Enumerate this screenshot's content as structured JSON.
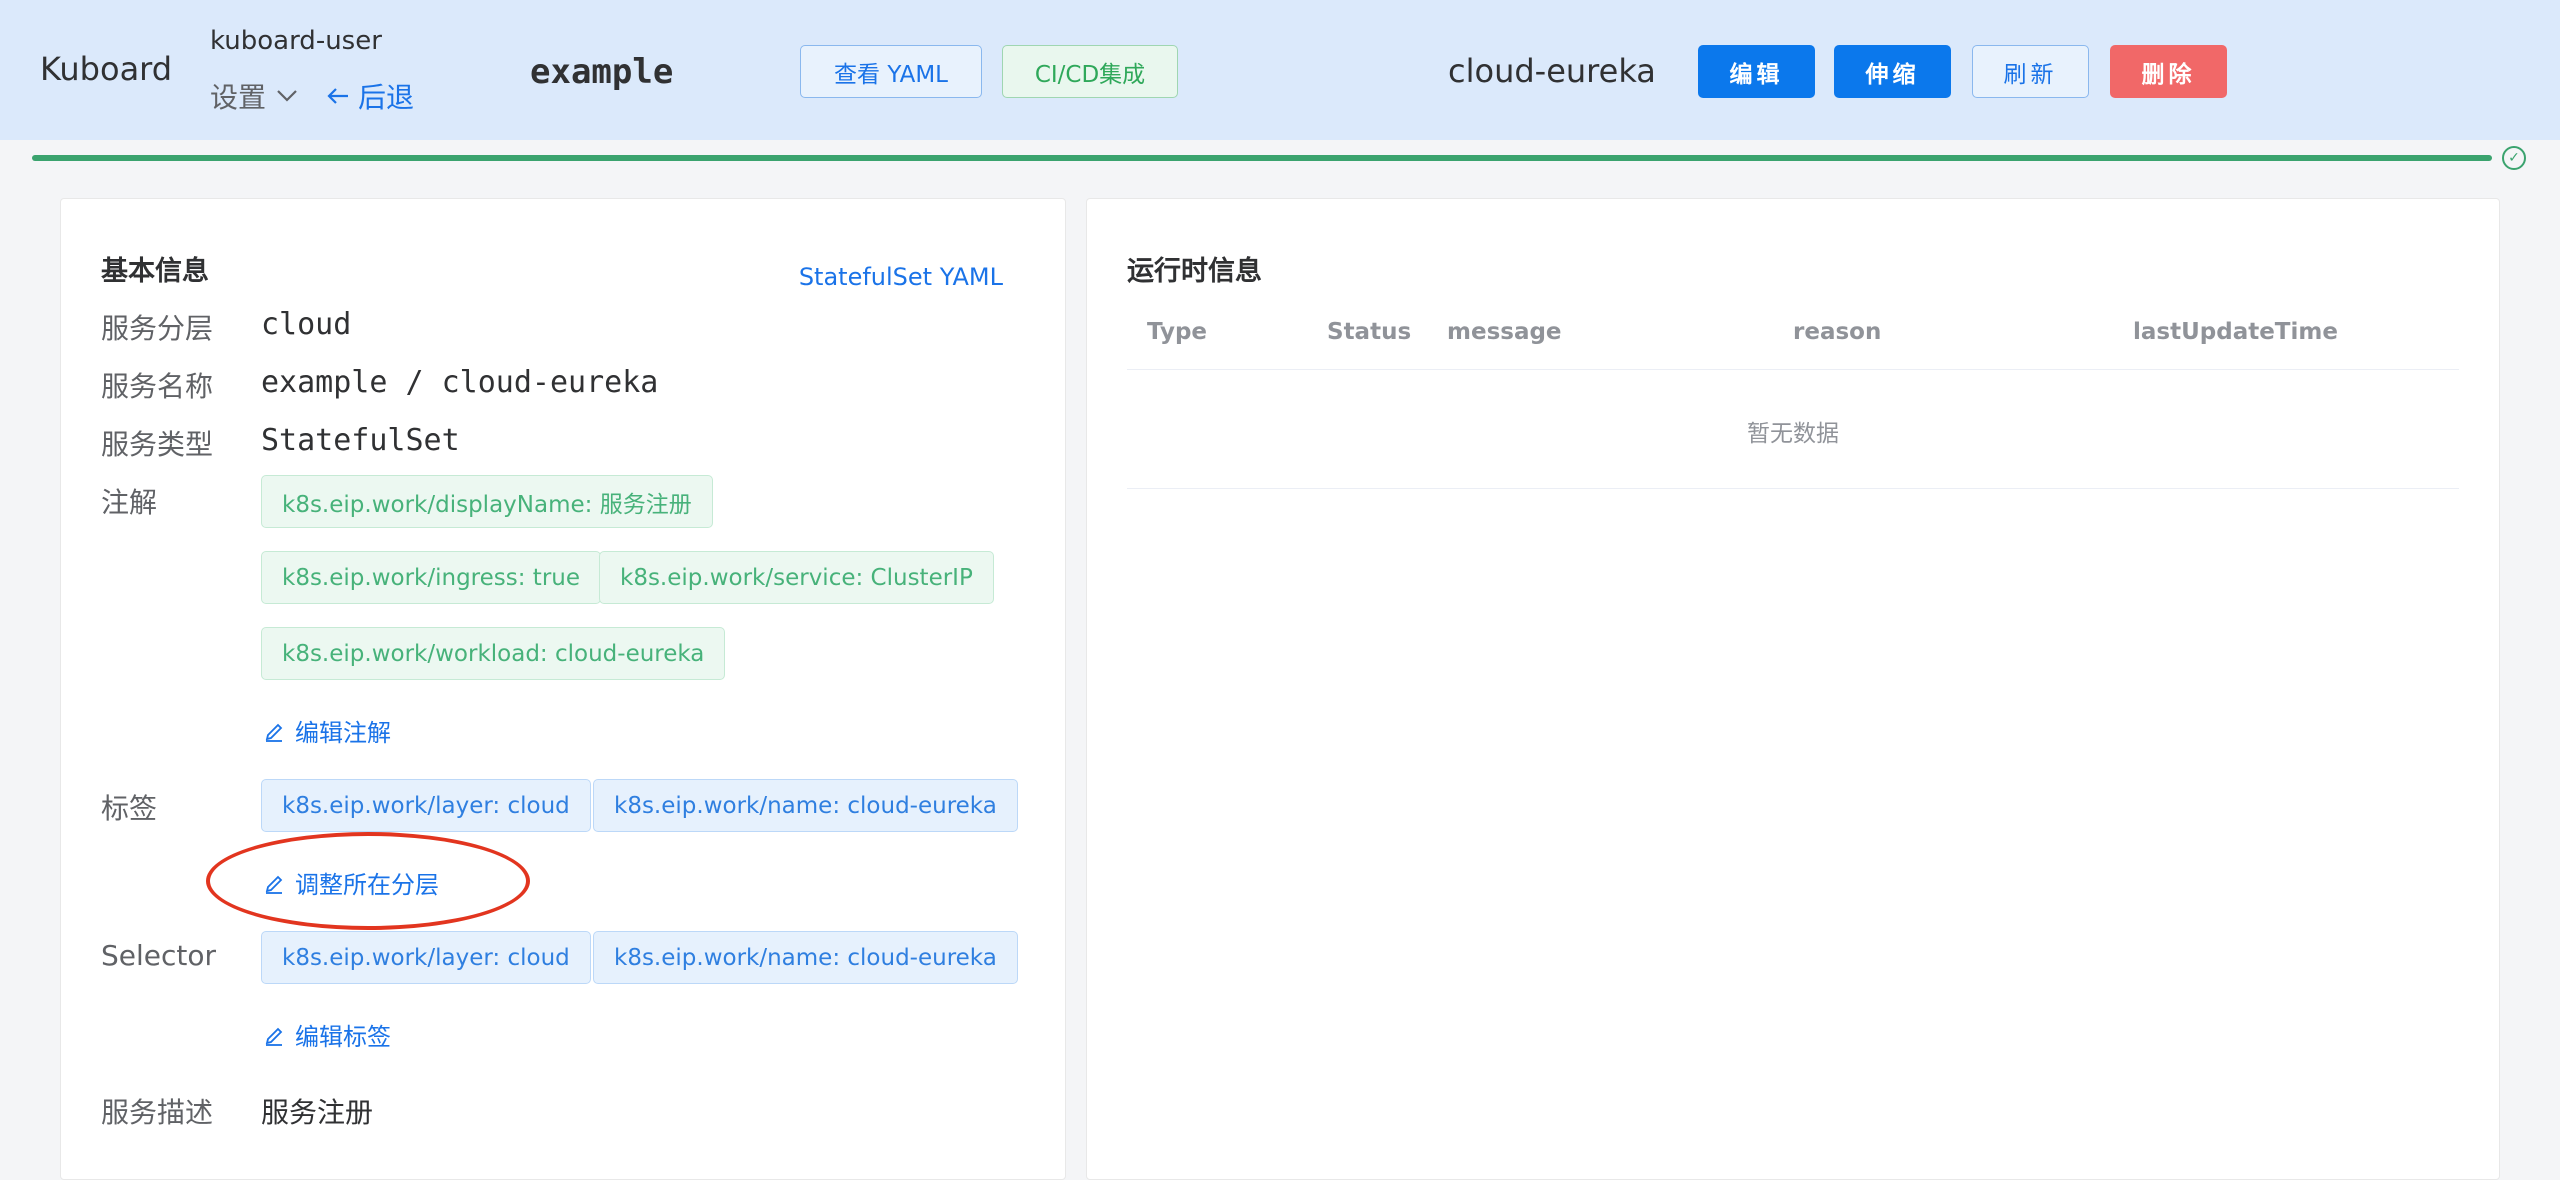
{
  "header": {
    "brand": "Kuboard",
    "user": "kuboard-user",
    "settings_label": "设置",
    "back_label": "后退",
    "namespace": "example",
    "view_yaml_label": "查看 YAML",
    "cicd_label": "CI/CD集成",
    "service_name": "cloud-eureka",
    "edit_label": "编辑",
    "scale_label": "伸缩",
    "refresh_label": "刷新",
    "delete_label": "删除"
  },
  "progress": {
    "percent": 100
  },
  "basic_info": {
    "title": "基本信息",
    "yaml_link": "StatefulSet YAML",
    "layer_label": "服务分层",
    "layer_value": "cloud",
    "name_label": "服务名称",
    "name_value": "example / cloud-eureka",
    "type_label": "服务类型",
    "type_value": "StatefulSet",
    "annotations_label": "注解",
    "annotations": [
      "k8s.eip.work/displayName: 服务注册",
      "k8s.eip.work/ingress: true",
      "k8s.eip.work/service: ClusterIP",
      "k8s.eip.work/workload: cloud-eureka"
    ],
    "edit_annotations": "编辑注解",
    "labels_label": "标签",
    "labels": [
      "k8s.eip.work/layer: cloud",
      "k8s.eip.work/name: cloud-eureka"
    ],
    "adjust_layer": "调整所在分层",
    "selector_label": "Selector",
    "selectors": [
      "k8s.eip.work/layer: cloud",
      "k8s.eip.work/name: cloud-eureka"
    ],
    "edit_labels": "编辑标签",
    "desc_label": "服务描述",
    "desc_value": "服务注册"
  },
  "runtime_info": {
    "title": "运行时信息",
    "columns": [
      "Type",
      "Status",
      "message",
      "reason",
      "lastUpdateTime"
    ],
    "empty_text": "暂无数据"
  },
  "colors": {
    "header_bg": "#dbe9fb",
    "primary": "#0b78ec",
    "danger": "#f16868",
    "success": "#3aa36e",
    "annotation_circle": "#e2351f"
  }
}
